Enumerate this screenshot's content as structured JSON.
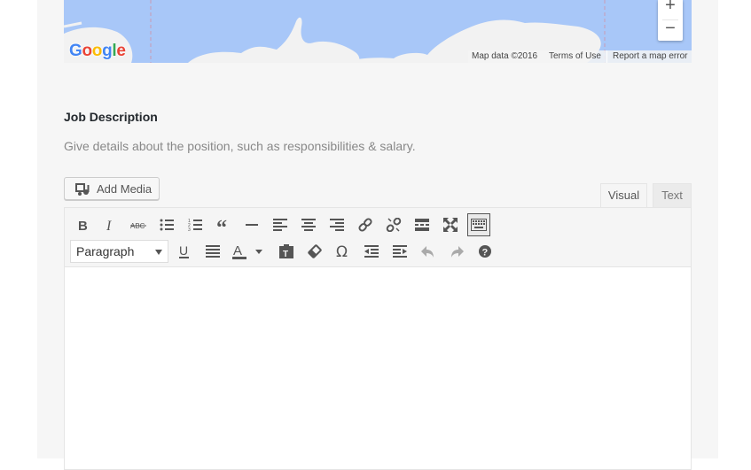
{
  "map": {
    "logo": [
      "G",
      "o",
      "o",
      "g",
      "l",
      "e"
    ],
    "logo_colors": [
      "#4285f4",
      "#ea4335",
      "#fbbc05",
      "#4285f4",
      "#34a853",
      "#ea4335"
    ],
    "zoom_in": "+",
    "zoom_out": "−",
    "attribution": {
      "map_data": "Map data ©2016",
      "terms": "Terms of Use",
      "report": "Report a map error"
    },
    "water_color": "#a8c7f8"
  },
  "job_description": {
    "title": "Job Description",
    "hint": "Give details about the position, such as responsibilities & salary."
  },
  "editor": {
    "add_media_label": "Add Media",
    "tabs": {
      "visual": "Visual",
      "text": "Text"
    },
    "format_select": {
      "selected": "Paragraph"
    },
    "toolbar_row1": [
      "bold-icon",
      "italic-icon",
      "strikethrough-icon",
      "bullet-list-icon",
      "numbered-list-icon",
      "blockquote-icon",
      "horizontal-line-icon",
      "align-left-icon",
      "align-center-icon",
      "align-right-icon",
      "insert-link-icon",
      "remove-link-icon",
      "read-more-icon",
      "fullscreen-icon",
      "toolbar-toggle-icon"
    ],
    "toolbar_row2": [
      "underline-icon",
      "justify-icon",
      "text-color-icon",
      "paste-text-icon",
      "clear-formatting-icon",
      "special-character-icon",
      "outdent-icon",
      "indent-icon",
      "undo-icon",
      "redo-icon",
      "help-icon"
    ]
  }
}
